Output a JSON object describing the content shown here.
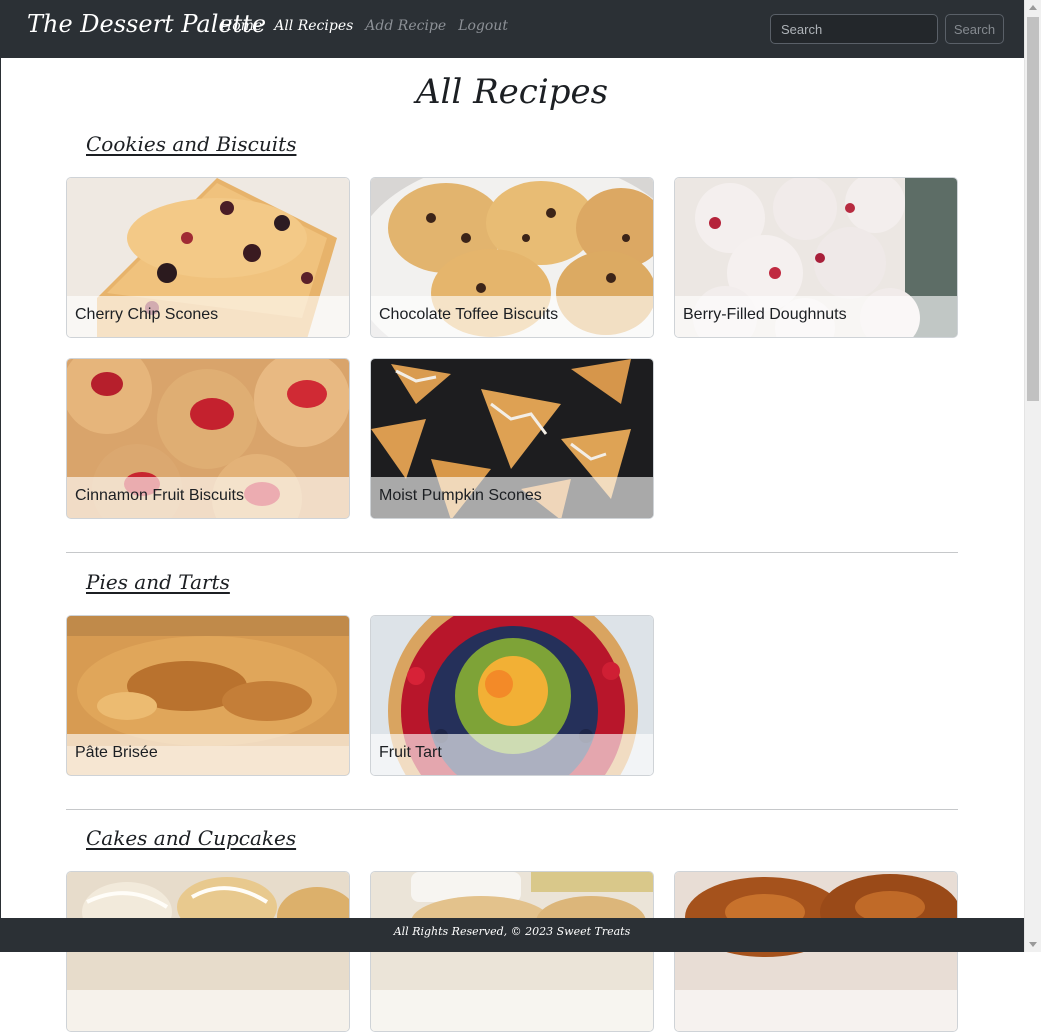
{
  "navbar": {
    "brand": "The Dessert Palette",
    "links": [
      "Home",
      "All Recipes",
      "Add Recipe",
      "Logout"
    ],
    "search_placeholder": "Search",
    "search_button": "Search"
  },
  "page_title": "All Recipes",
  "sections": [
    {
      "title": "Cookies and Biscuits",
      "cards": [
        "Cherry Chip Scones",
        "Chocolate Toffee Biscuits",
        "Berry-Filled Doughnuts",
        "Cinnamon Fruit Biscuits",
        "Moist Pumpkin Scones"
      ]
    },
    {
      "title": "Pies and Tarts",
      "cards": [
        "Pâte Brisée",
        "Fruit Tart"
      ]
    },
    {
      "title": "Cakes and Cupcakes",
      "cards": [
        "",
        "",
        ""
      ]
    }
  ],
  "footer": "All Rights Reserved, © 2023 Sweet Treats"
}
